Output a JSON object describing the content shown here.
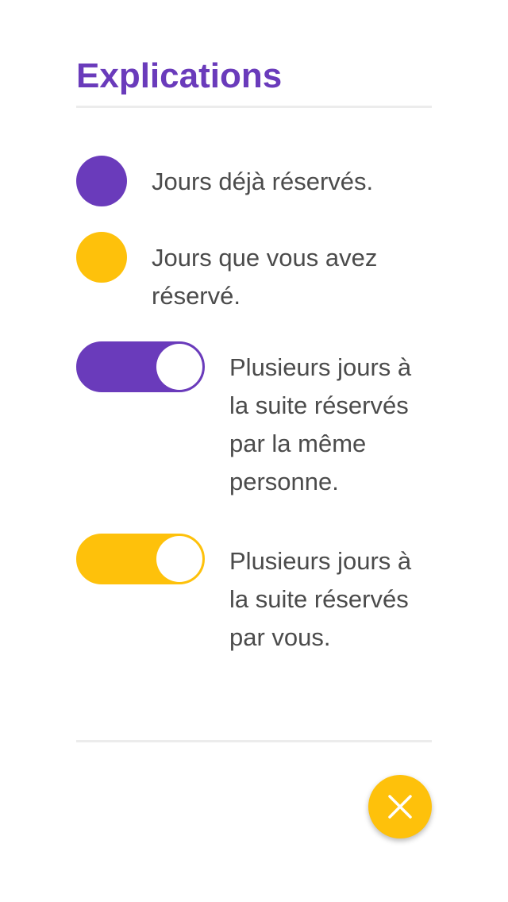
{
  "panel": {
    "title": "Explications"
  },
  "legend": {
    "booked_days": {
      "text": "Jours déjà réservés.",
      "color": "#6a3bbb"
    },
    "your_booked_days": {
      "text": "Jours que vous avez réservé.",
      "color": "#fec10b"
    },
    "consecutive_same_person": {
      "text": "Plusieurs jours à la suite réservés par la même personne.",
      "color": "#6a3bbb",
      "toggle_on": true
    },
    "consecutive_you": {
      "text": "Plusieurs jours à la suite réservés par vous.",
      "color": "#fec10b",
      "toggle_on": true
    }
  },
  "close_button": {
    "icon": "close-icon",
    "color": "#fec10b"
  }
}
